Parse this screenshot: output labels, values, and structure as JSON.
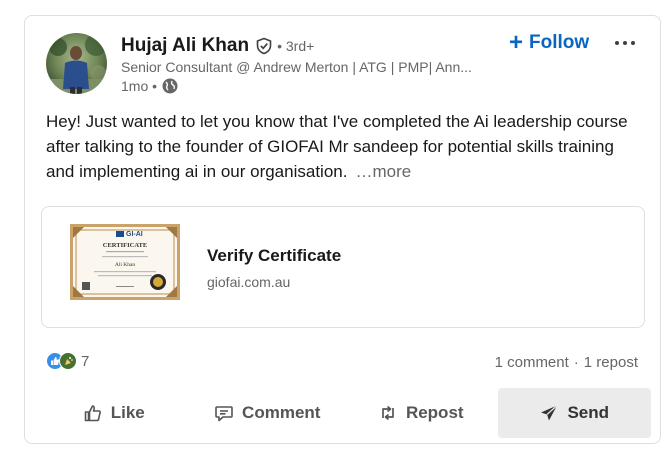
{
  "author": {
    "name": "Hujaj Ali Khan",
    "degree": "• 3rd+",
    "headline": "Senior Consultant @ Andrew Merton | ATG | PMP| Ann...",
    "time": "1mo •"
  },
  "header": {
    "follow_label": "Follow",
    "follow_plus": "+"
  },
  "post": {
    "text": "Hey! Just wanted to let you know that I've completed the Ai leadership course after talking to the founder of GIOFAI Mr sandeep for potential skills training and implementing ai in our organisation.",
    "see_more": "…more"
  },
  "article": {
    "title": "Verify Certificate",
    "domain": "giofai.com.au",
    "thumb": {
      "brand": "GI-AI",
      "heading": "CERTIFICATE",
      "recipient": "Ali Khan"
    }
  },
  "social": {
    "reaction_count": "7",
    "comments": "1 comment",
    "separator": "·",
    "reposts": "1 repost"
  },
  "actions": {
    "like": "Like",
    "comment": "Comment",
    "repost": "Repost",
    "send": "Send"
  },
  "colors": {
    "accent": "#0a66c2",
    "like_reaction": "#378fe9",
    "celebrate_reaction": "#44712e",
    "send_bg": "#ebebeb"
  },
  "icons": {
    "verified": "shield-check-icon",
    "visibility": "globe-icon",
    "more": "ellipsis-icon",
    "like": "thumbs-up-icon",
    "comment": "speech-bubble-icon",
    "repost": "repost-arrows-icon",
    "send": "paper-plane-icon"
  }
}
